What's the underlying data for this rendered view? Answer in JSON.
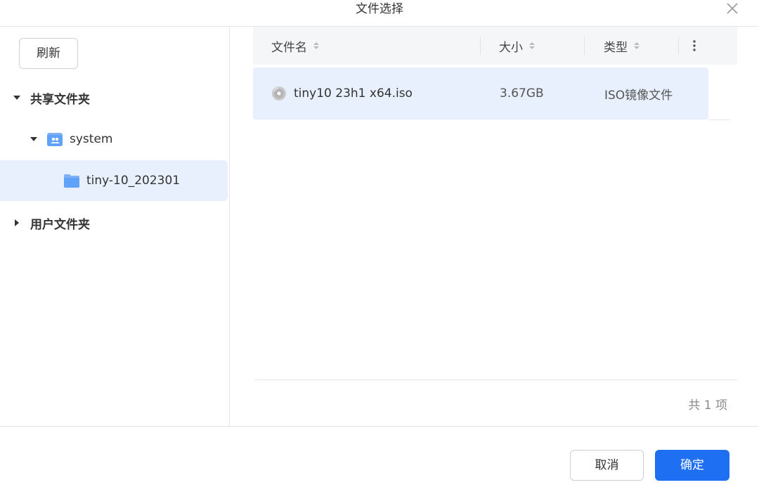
{
  "dialog": {
    "title": "文件选择"
  },
  "sidebar": {
    "refresh_label": "刷新",
    "tree": {
      "shared": {
        "label": "共享文件夹"
      },
      "system": {
        "label": "system"
      },
      "tiny": {
        "label": "tiny-10_202301"
      },
      "user": {
        "label": "用户文件夹"
      }
    }
  },
  "table": {
    "columns": [
      "文件名",
      "大小",
      "类型"
    ],
    "rows": [
      {
        "name": "tiny10 23h1 x64.iso",
        "size": "3.67GB",
        "type": "ISO镜像文件"
      }
    ],
    "count_text": "共 1 项"
  },
  "buttons": {
    "cancel": "取消",
    "ok": "确定"
  },
  "colors": {
    "accent": "#1e6ff2",
    "selected_bg": "#e8f0fd",
    "folder": "#5fa2f7"
  },
  "icons": [
    "close-icon",
    "caret-down-icon",
    "caret-right-icon",
    "shared-folder-icon",
    "folder-icon",
    "sort-icon",
    "more-vertical-icon",
    "disc-icon"
  ]
}
